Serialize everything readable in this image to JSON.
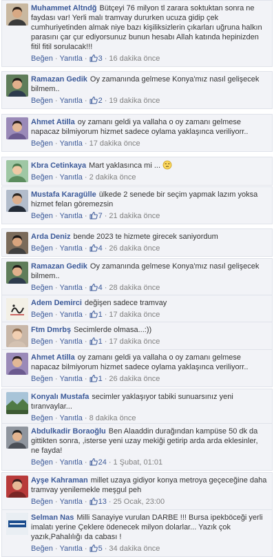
{
  "ui": {
    "like_label": "Beğen",
    "reply_label": "Yanıtla",
    "separator": "·"
  },
  "colors": {
    "author": "#3b5998",
    "text": "#333333",
    "meta": "#808080",
    "card_bg": "#f2f3f7",
    "card_border": "#dfe2ea"
  },
  "comments": [
    {
      "author": "Muhammet Altndğ",
      "text": "Bütçeyi 76 milyon tl zarara soktuktan sonra ne faydası var! Yerli malı tramvay dururken ucuza gidip çek cumhuriyetinden almak niye bazı kişiliksizlerin çıkarları uğruna halkın parasını çar çur ediyorsunuz bunun hesabı Allah katında hepinizden fitil fitil sorulacak!!!",
      "likes": "3",
      "time": "16 dakika önce",
      "avatar_icon": "profile-photo-man-dark-hair"
    },
    {
      "author": "Ramazan Gedik",
      "text": "Oy zamanında gelmese Konya'mız nasıl gelişecek bilmem..",
      "likes": "2",
      "time": "19 dakika önce",
      "avatar_icon": "profile-photo-man-short-hair"
    },
    {
      "author": "Ahmet Atilla",
      "text": "oy zamanı geldi ya vallaha o oy zamanı gelmese napacaz bilmiyorum hizmet sadece oylama yaklaşınca veriliyorr..",
      "likes": "",
      "time": "17 dakika önce",
      "avatar_icon": "profile-photo-man-purple-background"
    },
    {
      "author": "Kbra Cetinkaya",
      "text": "Mart yaklasınca mi ...",
      "emoji": "unamused-face-icon",
      "likes": "",
      "time": "2 dakika önce",
      "avatar_icon": "profile-photo-woman-headscarf"
    },
    {
      "author": "Mustafa Karagülle",
      "text": "ülkede 2 senede bir seçim yapmak lazım yoksa hizmet felan göremezsin",
      "likes": "7",
      "time": "21 dakika önce",
      "avatar_icon": "profile-photo-man-suit"
    },
    {
      "author": "Arda Deniz",
      "text": "bende 2023 te hizmete girecek saniyordum",
      "likes": "4",
      "time": "26 dakika önce",
      "avatar_icon": "profile-photo-young-man"
    },
    {
      "author": "Ramazan Gedik",
      "text": "Oy zamanında gelmese Konya'mız nasıl gelişecek bilmem..",
      "likes": "4",
      "time": "28 dakika önce",
      "avatar_icon": "profile-photo-man-short-hair"
    },
    {
      "author": "Adem Demirci",
      "text": "değişen sadece tramvay",
      "likes": "1",
      "time": "17 dakika önce",
      "avatar_icon": "profile-image-calligraphy"
    },
    {
      "author": "Ftm Dmrbş",
      "text": "Secimlerde olmasa...:))",
      "likes": "1",
      "time": "17 dakika önce",
      "avatar_icon": "profile-photo-child"
    },
    {
      "author": "Ahmet Atilla",
      "text": "oy zamanı geldi ya vallaha o oy zamanı gelmese napacaz bilmiyorum hizmet sadece oylama yaklaşınca veriliyorr..",
      "likes": "1",
      "time": "26 dakika önce",
      "avatar_icon": "profile-photo-man-purple-background"
    },
    {
      "author": "Konyalı Mustafa",
      "text": "secimler yaklaşıyor tabiki sunuarsınız yeni tıranvaylar...",
      "likes": "",
      "time": "8 dakika önce",
      "avatar_icon": "profile-photo-landscape"
    },
    {
      "author": "Abdulkadir Boraoğlu",
      "text": "Ben Alaaddin durağından kampüse 50 dk da gittikten sonra, ,isterse yeni uzay mekiği getirip arda arda eklesinler, ne fayda!",
      "likes": "24",
      "time": "1 Şubat, 01:01",
      "avatar_icon": "profile-photo-man-glasses"
    },
    {
      "author": "Ayşe Kahraman",
      "text": "millet uzaya gidiyor konya metroya geçeceğine daha tramvay yenilemekle meşgul peh",
      "likes": "13",
      "time": "25 Ocak, 23:00",
      "avatar_icon": "profile-photo-red-background"
    },
    {
      "author": "Selman Nas",
      "text": "Milli Sanayiye vurulan DARBE !!! Bursa ipekböceği yerli imalatı yerine Çeklere ödenecek milyon dolarlar... Yazık çok yazık,Pahalılığı da cabası !",
      "likes": "5",
      "time": "34 dakika önce",
      "avatar_icon": "profile-image-nereye-logo"
    }
  ]
}
